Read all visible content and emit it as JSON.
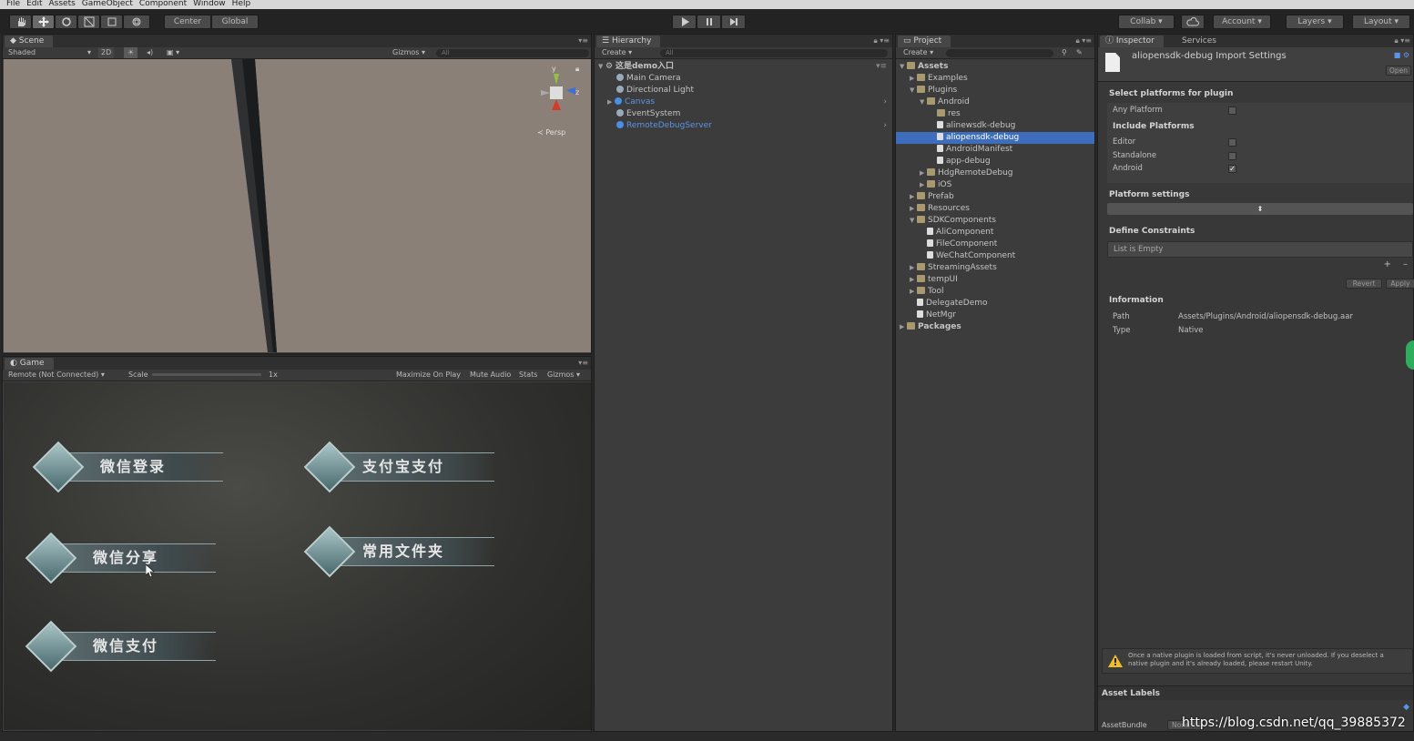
{
  "menu": [
    "File",
    "Edit",
    "Assets",
    "GameObject",
    "Component",
    "Window",
    "Help"
  ],
  "toolbar": {
    "pivot_center": "Center",
    "pivot_global": "Global",
    "collab": "Collab",
    "account": "Account",
    "layers": "Layers",
    "layout": "Layout"
  },
  "scene": {
    "tab": "Scene",
    "shading": "Shaded",
    "mode2d": "2D",
    "gizmos": "Gizmos",
    "search": "All",
    "persp": "Persp",
    "axis_y": "y",
    "axis_z": "z"
  },
  "game": {
    "tab": "Game",
    "display": "Remote (Not Connected)",
    "scale_label": "Scale",
    "scale_value": "1x",
    "maximize": "Maximize On Play",
    "mute": "Mute Audio",
    "stats": "Stats",
    "gizmos": "Gizmos",
    "buttons": [
      "微信登录",
      "支付宝支付",
      "微信分享",
      "常用文件夹",
      "微信支付"
    ]
  },
  "hierarchy": {
    "tab": "Hierarchy",
    "create": "Create",
    "search": "All",
    "scene_name": "这是demo入口",
    "items": [
      "Main Camera",
      "Directional Light",
      "Canvas",
      "EventSystem",
      "RemoteDebugServer"
    ]
  },
  "project": {
    "tab": "Project",
    "create": "Create",
    "items": [
      {
        "label": "Assets",
        "depth": 0,
        "arrow": "▼",
        "icon": "folder",
        "bold": true
      },
      {
        "label": "Examples",
        "depth": 1,
        "arrow": "▶",
        "icon": "folder"
      },
      {
        "label": "Plugins",
        "depth": 1,
        "arrow": "▼",
        "icon": "folder"
      },
      {
        "label": "Android",
        "depth": 2,
        "arrow": "▼",
        "icon": "folder"
      },
      {
        "label": "res",
        "depth": 3,
        "arrow": "",
        "icon": "folder"
      },
      {
        "label": "alinewsdk-debug",
        "depth": 3,
        "arrow": "",
        "icon": "file"
      },
      {
        "label": "aliopensdk-debug",
        "depth": 3,
        "arrow": "",
        "icon": "file",
        "selected": true
      },
      {
        "label": "AndroidManifest",
        "depth": 3,
        "arrow": "",
        "icon": "file"
      },
      {
        "label": "app-debug",
        "depth": 3,
        "arrow": "",
        "icon": "file"
      },
      {
        "label": "HdgRemoteDebug",
        "depth": 2,
        "arrow": "▶",
        "icon": "folder"
      },
      {
        "label": "iOS",
        "depth": 2,
        "arrow": "▶",
        "icon": "folder"
      },
      {
        "label": "Prefab",
        "depth": 1,
        "arrow": "▶",
        "icon": "folder"
      },
      {
        "label": "Resources",
        "depth": 1,
        "arrow": "▶",
        "icon": "folder"
      },
      {
        "label": "SDKComponents",
        "depth": 1,
        "arrow": "▼",
        "icon": "folder"
      },
      {
        "label": "AliComponent",
        "depth": 2,
        "arrow": "",
        "icon": "file"
      },
      {
        "label": "FileComponent",
        "depth": 2,
        "arrow": "",
        "icon": "file"
      },
      {
        "label": "WeChatComponent",
        "depth": 2,
        "arrow": "",
        "icon": "file"
      },
      {
        "label": "StreamingAssets",
        "depth": 1,
        "arrow": "▶",
        "icon": "folder"
      },
      {
        "label": "tempUI",
        "depth": 1,
        "arrow": "▶",
        "icon": "folder"
      },
      {
        "label": "Tool",
        "depth": 1,
        "arrow": "▶",
        "icon": "folder"
      },
      {
        "label": "DelegateDemo",
        "depth": 1,
        "arrow": "",
        "icon": "file"
      },
      {
        "label": "NetMgr",
        "depth": 1,
        "arrow": "",
        "icon": "file"
      },
      {
        "label": "Packages",
        "depth": 0,
        "arrow": "▶",
        "icon": "folder",
        "bold": true
      }
    ]
  },
  "inspector": {
    "tab": "Inspector",
    "tab2": "Services",
    "title": "aliopensdk-debug Import Settings",
    "open": "Open",
    "select_platforms": "Select platforms for plugin",
    "any_platform": "Any Platform",
    "include_platforms": "Include Platforms",
    "platforms": [
      "Editor",
      "Standalone",
      "Android"
    ],
    "platform_settings": "Platform settings",
    "define_constraints": "Define Constraints",
    "list_empty": "List is Empty",
    "revert": "Revert",
    "apply": "Apply",
    "information": "Information",
    "path_label": "Path",
    "path_value": "Assets/Plugins/Android/aliopensdk-debug.aar",
    "type_label": "Type",
    "type_value": "Native",
    "warning": "Once a native plugin is loaded from script, it's never unloaded. If you deselect a native plugin and it's already loaded, please restart Unity.",
    "asset_labels": "Asset Labels",
    "asset_bundle": "AssetBundle",
    "none": "None"
  },
  "watermark": "https://blog.csdn.net/qq_39885372"
}
